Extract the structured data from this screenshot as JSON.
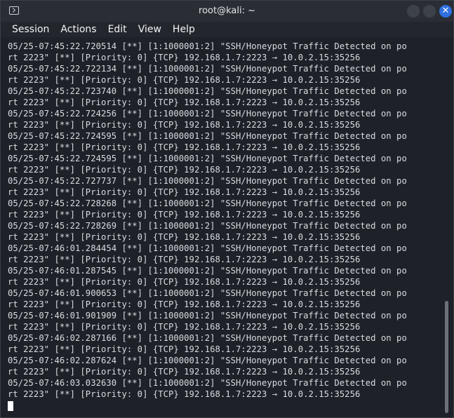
{
  "window": {
    "title": "root@kali: ~",
    "close_glyph": "✕"
  },
  "menu": [
    "Session",
    "Actions",
    "Edit",
    "View",
    "Help"
  ],
  "terminal": {
    "alerts": [
      {
        "l1": "05/25-07:45:22.720514 [**] [1:1000001:2] \"SSH/Honeypot Traffic Detected on po",
        "l2": "rt 2223\" [**] [Priority: 0] {TCP} 192.168.1.7:2223 → 10.0.2.15:35256"
      },
      {
        "l1": "05/25-07:45:22.722134 [**] [1:1000001:2] \"SSH/Honeypot Traffic Detected on po",
        "l2": "rt 2223\" [**] [Priority: 0] {TCP} 192.168.1.7:2223 → 10.0.2.15:35256"
      },
      {
        "l1": "05/25-07:45:22.723740 [**] [1:1000001:2] \"SSH/Honeypot Traffic Detected on po",
        "l2": "rt 2223\" [**] [Priority: 0] {TCP} 192.168.1.7:2223 → 10.0.2.15:35256"
      },
      {
        "l1": "05/25-07:45:22.724256 [**] [1:1000001:2] \"SSH/Honeypot Traffic Detected on po",
        "l2": "rt 2223\" [**] [Priority: 0] {TCP} 192.168.1.7:2223 → 10.0.2.15:35256"
      },
      {
        "l1": "05/25-07:45:22.724595 [**] [1:1000001:2] \"SSH/Honeypot Traffic Detected on po",
        "l2": "rt 2223\" [**] [Priority: 0] {TCP} 192.168.1.7:2223 → 10.0.2.15:35256"
      },
      {
        "l1": "05/25-07:45:22.724595 [**] [1:1000001:2] \"SSH/Honeypot Traffic Detected on po",
        "l2": "rt 2223\" [**] [Priority: 0] {TCP} 192.168.1.7:2223 → 10.0.2.15:35256"
      },
      {
        "l1": "05/25-07:45:22.727737 [**] [1:1000001:2] \"SSH/Honeypot Traffic Detected on po",
        "l2": "rt 2223\" [**] [Priority: 0] {TCP} 192.168.1.7:2223 → 10.0.2.15:35256"
      },
      {
        "l1": "05/25-07:45:22.728268 [**] [1:1000001:2] \"SSH/Honeypot Traffic Detected on po",
        "l2": "rt 2223\" [**] [Priority: 0] {TCP} 192.168.1.7:2223 → 10.0.2.15:35256"
      },
      {
        "l1": "05/25-07:45:22.728269 [**] [1:1000001:2] \"SSH/Honeypot Traffic Detected on po",
        "l2": "rt 2223\" [**] [Priority: 0] {TCP} 192.168.1.7:2223 → 10.0.2.15:35256"
      },
      {
        "l1": "05/25-07:46:01.284454 [**] [1:1000001:2] \"SSH/Honeypot Traffic Detected on po",
        "l2": "rt 2223\" [**] [Priority: 0] {TCP} 192.168.1.7:2223 → 10.0.2.15:35256"
      },
      {
        "l1": "05/25-07:46:01.287545 [**] [1:1000001:2] \"SSH/Honeypot Traffic Detected on po",
        "l2": "rt 2223\" [**] [Priority: 0] {TCP} 192.168.1.7:2223 → 10.0.2.15:35256"
      },
      {
        "l1": "05/25-07:46:01.900653 [**] [1:1000001:2] \"SSH/Honeypot Traffic Detected on po",
        "l2": "rt 2223\" [**] [Priority: 0] {TCP} 192.168.1.7:2223 → 10.0.2.15:35256"
      },
      {
        "l1": "05/25-07:46:01.901909 [**] [1:1000001:2] \"SSH/Honeypot Traffic Detected on po",
        "l2": "rt 2223\" [**] [Priority: 0] {TCP} 192.168.1.7:2223 → 10.0.2.15:35256"
      },
      {
        "l1": "05/25-07:46:02.287166 [**] [1:1000001:2] \"SSH/Honeypot Traffic Detected on po",
        "l2": "rt 2223\" [**] [Priority: 0] {TCP} 192.168.1.7:2223 → 10.0.2.15:35256"
      },
      {
        "l1": "05/25-07:46:02.287624 [**] [1:1000001:2] \"SSH/Honeypot Traffic Detected on po",
        "l2": "rt 2223\" [**] [Priority: 0] {TCP} 192.168.1.7:2223 → 10.0.2.15:35256"
      },
      {
        "l1": "05/25-07:46:03.032630 [**] [1:1000001:2] \"SSH/Honeypot Traffic Detected on po",
        "l2": "rt 2223\" [**] [Priority: 0] {TCP} 192.168.1.7:2223 → 10.0.2.15:35256"
      }
    ]
  },
  "colors": {
    "titlebar_bg": "#2a2d34",
    "terminal_bg": "#1e2128",
    "terminal_text": "#d8dce1",
    "close_button": "#2f6fe0"
  },
  "icons": {
    "app": "terminal-icon",
    "minimize": "minimize-icon",
    "maximize": "maximize-icon",
    "close": "close-icon"
  }
}
